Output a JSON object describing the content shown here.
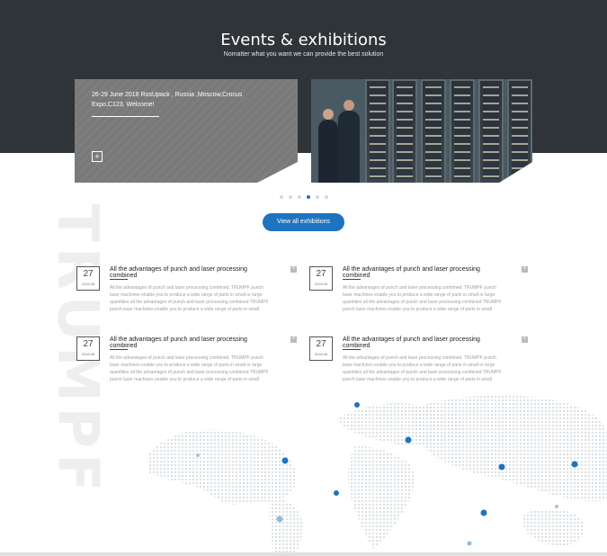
{
  "hero": {
    "title": "Events & exhibitions",
    "subtitle": "Nomatter what you want we can provide the best solution"
  },
  "featured": {
    "title": "26-29 June 2018 RosUpack , Russia ,Moscow,Crocus Expo,C123, Welcome!",
    "plus_icon": "+"
  },
  "slider": {
    "dot_count": 6,
    "active_index": 3
  },
  "button": {
    "label": "View all exhibitions"
  },
  "watermark": {
    "text": "TRUMPF"
  },
  "news": [
    {
      "day": "27",
      "ym": "2018-08",
      "title": "All the advantages of punch and laser processing combined",
      "body": "All the advantages of punch and laser processing combined. TRUMPF punch laser machines enable you to produce a wide range of parts in small or large quantities all the advantages of punch and laser processing combined TRUMPF punch laser machines enable you to produce a wide range of parts in small",
      "more": "+"
    },
    {
      "day": "27",
      "ym": "2018-08",
      "title": "All the advantages of punch and laser processing combined",
      "body": "All the advantages of punch and laser processing combined. TRUMPF punch laser machines enable you to produce a wide range of parts in small or large quantities all the advantages of punch and laser processing combined TRUMPF punch laser machines enable you to produce a wide range of parts in small",
      "more": "+"
    },
    {
      "day": "27",
      "ym": "2018-08",
      "title": "All the advantages of punch and laser processing combined",
      "body": "All the advantages of punch and laser processing combined. TRUMPF punch laser machines enable you to produce a wide range of parts in small or large quantities all the advantages of punch and laser processing combined TRUMPF punch laser machines enable you to produce a wide range of parts in small",
      "more": "+"
    },
    {
      "day": "27",
      "ym": "2018-08",
      "title": "All the advantages of punch and laser processing combined",
      "body": "All the advantages of punch and laser processing combined. TRUMPF punch laser machines enable you to produce a wide range of parts in small or large quantities all the advantages of punch and laser processing combined TRUMPF punch laser machines enable you to produce a wide range of parts in small",
      "more": "+"
    }
  ],
  "colors": {
    "hero_bg": "#2e3438",
    "accent": "#1e73be",
    "map_dot": "#cfd6dc",
    "marker": "#1e73be"
  }
}
